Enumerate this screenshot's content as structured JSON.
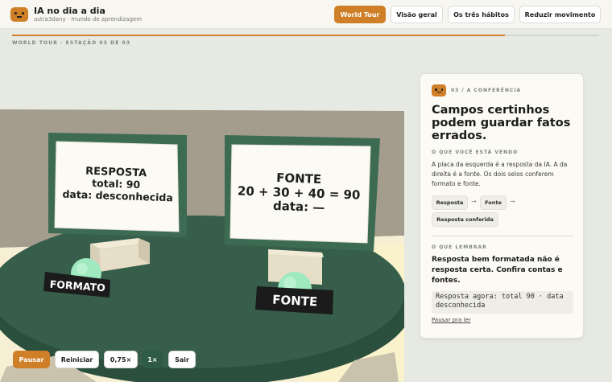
{
  "header": {
    "brand_title": "IA no dia a dia",
    "brand_subtitle": "astra3dany · mundo de aprendizagem",
    "nav": [
      {
        "label": "World Tour",
        "active": true
      },
      {
        "label": "Visão geral",
        "active": false
      },
      {
        "label": "Os três hábitos",
        "active": false
      },
      {
        "label": "Reduzir movimento",
        "active": false
      }
    ]
  },
  "progress": {
    "fraction": 0.84
  },
  "station_label": "WORLD TOUR · ESTAÇÃO 03 DE 03",
  "scene": {
    "left_board": {
      "title": "RESPOSTA",
      "line1": "total: 90",
      "line2": "data: desconhecida"
    },
    "right_board": {
      "title": "FONTE",
      "line1": "20 + 30 + 40 = 90",
      "line2": "data: —"
    },
    "left_sign": "FORMATO",
    "right_sign": "FONTE"
  },
  "controls": [
    {
      "label": "Pausar",
      "style": "primary"
    },
    {
      "label": "Reiniciar",
      "style": "default"
    },
    {
      "label": "0,75×",
      "style": "default"
    },
    {
      "label": "1×",
      "style": "dark"
    },
    {
      "label": "Sair",
      "style": "default"
    }
  ],
  "panel": {
    "kicker": "03 / A CONFERÊNCIA",
    "title": "Campos certinhos podem guardar fatos errados.",
    "seeing_label": "O QUE VOCÊ ESTÁ VENDO",
    "seeing_text": "A placa da esquerda é a resposta da IA. A da direita é a fonte. Os dois selos conferem formato e fonte.",
    "chips": [
      "Resposta",
      "Fonte",
      "Resposta conferida"
    ],
    "remember_label": "O QUE LEMBRAR",
    "remember_text": "Resposta bem formatada não é resposta certa. Confira contas e fontes.",
    "answer_now": "Resposta agora: total 90 · data desconhecida",
    "pause_link": "Pausar pra ler"
  },
  "colors": {
    "accent": "#cf7f27",
    "table_green": "#365e4a",
    "board_green": "#3f6f54",
    "background": "#e7eae3"
  }
}
